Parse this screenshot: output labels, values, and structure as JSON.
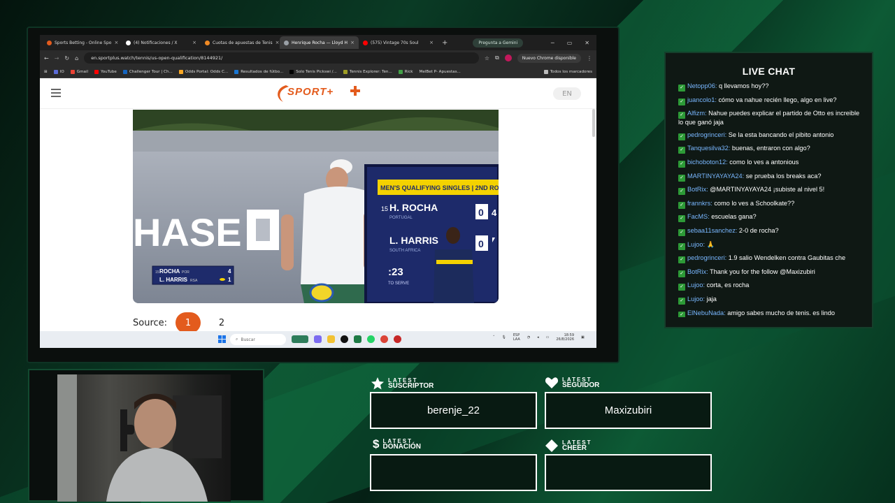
{
  "browser": {
    "tabs": [
      {
        "title": "Sports Betting - Online Spo",
        "color": "#e35b1d",
        "active": false
      },
      {
        "title": "(4) Notificaciones / X",
        "color": "#ffffff",
        "active": false
      },
      {
        "title": "Cuotas de apuestas de Tenis",
        "color": "#f08a24",
        "active": false
      },
      {
        "title": "Henrique Rocha — Lloyd H",
        "color": "#9aa0a6",
        "active": true
      },
      {
        "title": "(575) Vintage 70s Soul",
        "color": "#ff0000",
        "active": false
      }
    ],
    "new_tab": "+",
    "gemini": "Pregunta a Gemini",
    "url": "en.sportplus.watch/tennis/us-open-qualification/8144921/",
    "chrome_update": "Nuevo Chrome disponible",
    "bookmarks": [
      "IO",
      "Gmail",
      "YouTube",
      "Challenger Tour | Ch...",
      "Odds Portal: Odds C...",
      "Resultados de fútbo...",
      "Solo Tenis Pickswi /...",
      "Tennis Explorer: Ten...",
      "Rick",
      "MelBet P- Apuestas..."
    ],
    "all_bookmarks": "Todos los marcadores"
  },
  "site": {
    "logo": "SPORT+",
    "lang": "EN",
    "source_label": "Source:",
    "sources": [
      "1",
      "2"
    ]
  },
  "video": {
    "sponsor": "HASE",
    "board_title": "MEN'S QUALIFYING SINGLES | 2ND ROUND",
    "p1_seed": "15",
    "p1_name": "H. ROCHA",
    "p1_country": "PORTUGAL",
    "p1_score": "0",
    "p1_partial": "4",
    "p2_name": "L. HARRIS",
    "p2_country": "SOUTH AFRICA",
    "p2_score": "0",
    "clock": ":23",
    "clock_label": "TO SERVE",
    "mini_p1": "ROCHA",
    "mini_p1_seed": "15",
    "mini_p1_cc": "POR",
    "mini_p1_score": "4",
    "mini_p2": "L. HARRIS",
    "mini_p2_cc": "RSA",
    "mini_p2_score": "1"
  },
  "taskbar": {
    "search": "Buscar",
    "lang1": "ESP",
    "lang2": "LAA",
    "time": "18:59",
    "date": "26/8/2026"
  },
  "chat": {
    "title": "LIVE CHAT",
    "messages": [
      {
        "user": "Netopp06",
        "text": "q llevamos hoy??"
      },
      {
        "user": "juancolo1",
        "text": "cómo va nahue recién llego, algo en live?"
      },
      {
        "user": "Alfizm",
        "text": "Nahue puedes explicar el partido de Otto es increible lo que ganó jaja"
      },
      {
        "user": "pedrogrinceri",
        "text": "Se la esta bancando el pibito antonio"
      },
      {
        "user": "Tanquesilva32",
        "text": "buenas, entraron con algo?"
      },
      {
        "user": "bichoboton12",
        "text": "como lo ves a antonious"
      },
      {
        "user": "MARTINYAYAYA24",
        "text": "se prueba los breaks aca?"
      },
      {
        "user": "BotRix",
        "text": "@MARTINYAYAYA24 ¡subiste al nivel 5!"
      },
      {
        "user": "frannkrs",
        "text": "como lo ves a Schoolkate??"
      },
      {
        "user": "FacMS",
        "text": "escuelas gana?"
      },
      {
        "user": "sebaa11sanchez",
        "text": "2-0 de rocha?"
      },
      {
        "user": "Lujoo",
        "text": "🙏"
      },
      {
        "user": "pedrogrinceri",
        "text": "1.9 salio Wendelken contra Gaubitas che"
      },
      {
        "user": "BotRix",
        "text": "Thank you for the follow @Maxizubiri"
      },
      {
        "user": "Lujoo",
        "text": "corta, es rocha"
      },
      {
        "user": "Lujoo",
        "text": "jaja"
      },
      {
        "user": "ElNebuNada",
        "text": "amigo sabes mucho de tenis. es lindo escucharte y leerte PA"
      }
    ]
  },
  "alerts": {
    "sub_small": "LATEST",
    "sub_big": "SUSCRIPTOR",
    "sub_value": "berenje_22",
    "fol_small": "LATEST",
    "fol_big": "SEGUIDOR",
    "fol_value": "Maxizubiri",
    "don_small": "LATEST",
    "don_big": "DONACIÓN",
    "don_value": "",
    "cheer_small": "LATEST",
    "cheer_big": "CHEER",
    "cheer_value": ""
  }
}
